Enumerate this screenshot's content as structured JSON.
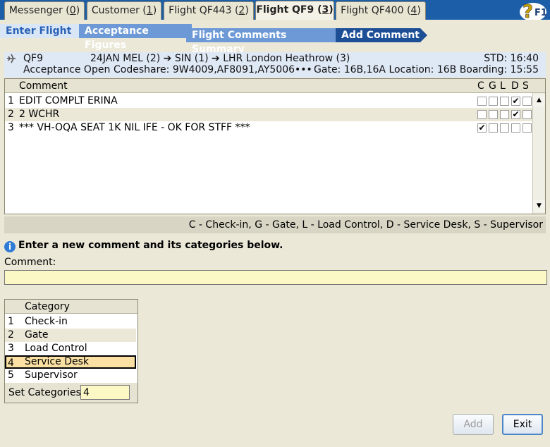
{
  "tabs": [
    {
      "label": "Messenger",
      "count": "0"
    },
    {
      "label": "Customer",
      "count": "1"
    },
    {
      "label": "Flight QF443",
      "count": "2"
    },
    {
      "label": "Flight QF9",
      "count": "3"
    },
    {
      "label": "Flight QF400",
      "count": "4"
    }
  ],
  "help": {
    "label": "F1"
  },
  "steps": [
    "Enter Flight",
    "Acceptance Figures",
    "Flight Comments Summary",
    "Add Comment"
  ],
  "flight": {
    "number": "QF9",
    "route": "24JAN MEL (2) ➔ SIN (1) ➔ LHR London Heathrow (3)",
    "std": "STD: 16:40",
    "status": "Acceptance Open",
    "codeshare": "Codeshare: 9W4009,AF8091,AY5006•••",
    "gate_info": "Gate: 16B,16A  Location: 16B  Boarding: 15:55"
  },
  "comments_table": {
    "header": "Comment",
    "col_heads": [
      "C",
      "G",
      "L",
      "D",
      "S"
    ],
    "rows": [
      {
        "num": "1",
        "text": "EDIT COMPLT ERINA",
        "checks": [
          false,
          false,
          false,
          true,
          false
        ]
      },
      {
        "num": "2",
        "text": "2 WCHR",
        "checks": [
          false,
          false,
          false,
          true,
          false
        ]
      },
      {
        "num": "3",
        "text": "*** VH-OQA SEAT 1K NIL IFE - OK FOR STFF ***",
        "checks": [
          true,
          false,
          false,
          false,
          false
        ]
      }
    ]
  },
  "legend": "C - Check-in, G - Gate, L - Load Control, D - Service Desk, S - Supervisor",
  "instruction": "Enter a new comment and its categories below.",
  "comment_label": "Comment:",
  "comment_value": "",
  "categories": {
    "header": "Category",
    "items": [
      {
        "num": "1",
        "label": "Check-in"
      },
      {
        "num": "2",
        "label": "Gate"
      },
      {
        "num": "3",
        "label": "Load Control"
      },
      {
        "num": "4",
        "label": "Service Desk"
      },
      {
        "num": "5",
        "label": "Supervisor"
      }
    ],
    "selected": "4"
  },
  "set_categories": {
    "label": "Set Categories:",
    "value": "4"
  },
  "buttons": {
    "add": "Add",
    "exit": "Exit"
  }
}
